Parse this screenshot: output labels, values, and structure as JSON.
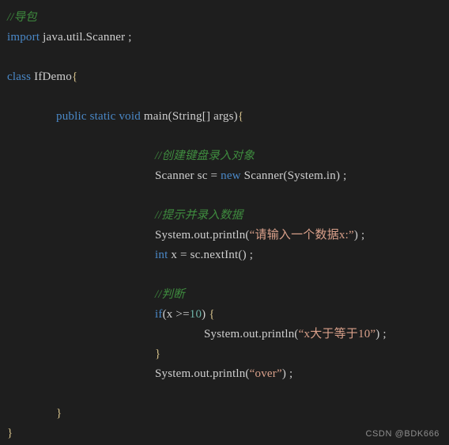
{
  "editor": {
    "language": "Java",
    "background_color": "#1e1e1e",
    "theme_colors": {
      "keyword": "#4a88c7",
      "comment": "#3f8c3f",
      "string": "#d9a08a",
      "number": "#6fb3a8",
      "plain_text": "#cfcfcf",
      "brace": "#d4c08a",
      "watermark": "#8e8e8e"
    }
  },
  "code": {
    "lines": [
      {
        "indent": 0,
        "blank": false,
        "tokens": [
          {
            "t": "//导包",
            "c": "comment"
          }
        ]
      },
      {
        "indent": 0,
        "blank": false,
        "tokens": [
          {
            "t": "import",
            "c": "kw"
          },
          {
            "t": " java.util.Scanner ;",
            "c": "plain"
          }
        ]
      },
      {
        "indent": 0,
        "blank": true,
        "tokens": []
      },
      {
        "indent": 0,
        "blank": false,
        "tokens": [
          {
            "t": "class",
            "c": "kw"
          },
          {
            "t": " IfDemo",
            "c": "plain"
          },
          {
            "t": "{",
            "c": "brace"
          }
        ]
      },
      {
        "indent": 0,
        "blank": true,
        "tokens": []
      },
      {
        "indent": 1,
        "blank": false,
        "tokens": [
          {
            "t": "public static void",
            "c": "kw"
          },
          {
            "t": " main",
            "c": "plain"
          },
          {
            "t": "(",
            "c": "punct"
          },
          {
            "t": "String[] args",
            "c": "plain"
          },
          {
            "t": ")",
            "c": "punct"
          },
          {
            "t": "{",
            "c": "brace"
          }
        ]
      },
      {
        "indent": 0,
        "blank": true,
        "tokens": []
      },
      {
        "indent": 2,
        "blank": false,
        "tokens": [
          {
            "t": "//创建键盘录入对象",
            "c": "comment"
          }
        ]
      },
      {
        "indent": 2,
        "blank": false,
        "tokens": [
          {
            "t": "Scanner sc = ",
            "c": "plain"
          },
          {
            "t": "new",
            "c": "kw"
          },
          {
            "t": " Scanner(System.in) ;",
            "c": "plain"
          }
        ]
      },
      {
        "indent": 0,
        "blank": true,
        "tokens": []
      },
      {
        "indent": 2,
        "blank": false,
        "tokens": [
          {
            "t": "//提示并录入数据",
            "c": "comment"
          }
        ]
      },
      {
        "indent": 2,
        "blank": false,
        "tokens": [
          {
            "t": "System.out.println(",
            "c": "plain"
          },
          {
            "t": "“请输入一个数据x:”",
            "c": "str"
          },
          {
            "t": ") ;",
            "c": "plain"
          }
        ]
      },
      {
        "indent": 2,
        "blank": false,
        "tokens": [
          {
            "t": "int",
            "c": "kw"
          },
          {
            "t": " x = sc.nextInt() ;",
            "c": "plain"
          }
        ]
      },
      {
        "indent": 0,
        "blank": true,
        "tokens": []
      },
      {
        "indent": 2,
        "blank": false,
        "tokens": [
          {
            "t": "//判断",
            "c": "comment"
          }
        ]
      },
      {
        "indent": 2,
        "blank": false,
        "tokens": [
          {
            "t": "if",
            "c": "kw"
          },
          {
            "t": "(x >=",
            "c": "plain"
          },
          {
            "t": "10",
            "c": "num"
          },
          {
            "t": ") ",
            "c": "plain"
          },
          {
            "t": "{",
            "c": "brace"
          }
        ]
      },
      {
        "indent": 3,
        "blank": false,
        "tokens": [
          {
            "t": "System.out.println(",
            "c": "plain"
          },
          {
            "t": "“x大于等于10”",
            "c": "str"
          },
          {
            "t": ") ;",
            "c": "plain"
          }
        ]
      },
      {
        "indent": 2,
        "blank": false,
        "tokens": [
          {
            "t": "}",
            "c": "brace"
          }
        ]
      },
      {
        "indent": 2,
        "blank": false,
        "tokens": [
          {
            "t": "System.out.println(",
            "c": "plain"
          },
          {
            "t": "“over”",
            "c": "str"
          },
          {
            "t": ") ;",
            "c": "plain"
          }
        ]
      },
      {
        "indent": 0,
        "blank": true,
        "tokens": []
      },
      {
        "indent": 1,
        "blank": false,
        "tokens": [
          {
            "t": "}",
            "c": "brace"
          }
        ]
      },
      {
        "indent": 0,
        "blank": false,
        "tokens": [
          {
            "t": "}",
            "c": "brace"
          }
        ]
      }
    ]
  },
  "watermark": {
    "text": "CSDN @BDK666"
  }
}
